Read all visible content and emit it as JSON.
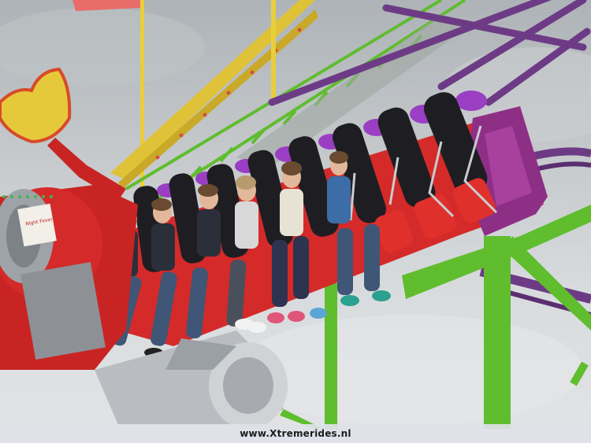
{
  "photo": {
    "subject": "swinging arm amusement ride with riders",
    "watermark": "www.Xtremerides.nl",
    "sign_text": "Night Fever",
    "colors": {
      "sky": "#c5c9cc",
      "ride_red": "#d42a2a",
      "ride_purple": "#8e2f86",
      "truss_green": "#5fbd2e",
      "track_purple": "#6d3b86",
      "truss_yellow": "#e0c238",
      "seat_black": "#1e1e22",
      "helmet_purple": "#9a3fc4",
      "hub_grey": "#9ea3a8"
    }
  }
}
